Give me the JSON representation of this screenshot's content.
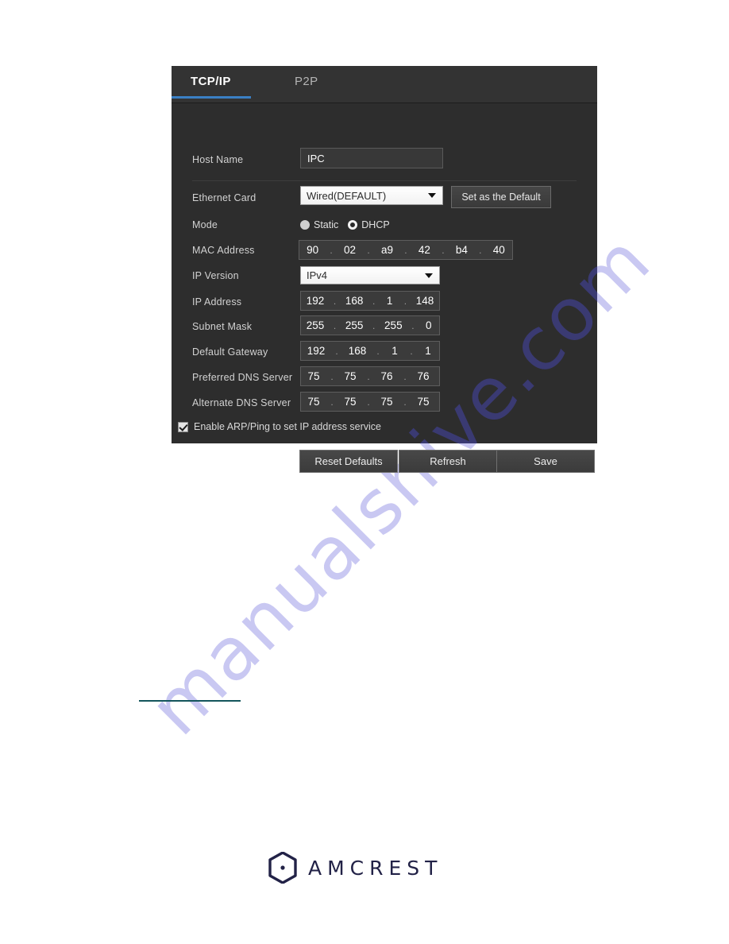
{
  "page": {
    "watermark_text": "manualshive.com",
    "watermark_color": "#c9c8f2"
  },
  "panel": {
    "accent_color": "#3a7fc4",
    "background_color": "#2d2d2d",
    "tabs": [
      {
        "id": "tcpip",
        "label": "TCP/IP",
        "active": true
      },
      {
        "id": "p2p",
        "label": "P2P",
        "active": false
      }
    ],
    "rows": {
      "host_name": {
        "label": "Host Name",
        "value": "IPC"
      },
      "ethernet_card": {
        "label": "Ethernet Card",
        "value": "Wired(DEFAULT)",
        "set_default_button": "Set as the Default"
      },
      "mode": {
        "label": "Mode",
        "options": [
          {
            "label": "Static",
            "selected": false
          },
          {
            "label": "DHCP",
            "selected": true
          }
        ]
      },
      "mac_address": {
        "label": "MAC Address",
        "octets": [
          "90",
          "02",
          "a9",
          "42",
          "b4",
          "40"
        ]
      },
      "ip_version": {
        "label": "IP Version",
        "value": "IPv4"
      },
      "ip_address": {
        "label": "IP Address",
        "octets": [
          "192",
          "168",
          "1",
          "148"
        ]
      },
      "subnet_mask": {
        "label": "Subnet Mask",
        "octets": [
          "255",
          "255",
          "255",
          "0"
        ]
      },
      "default_gateway": {
        "label": "Default Gateway",
        "octets": [
          "192",
          "168",
          "1",
          "1"
        ]
      },
      "preferred_dns": {
        "label": "Preferred DNS Server",
        "octets": [
          "75",
          "75",
          "76",
          "76"
        ]
      },
      "alternate_dns": {
        "label": "Alternate DNS Server",
        "octets": [
          "75",
          "75",
          "75",
          "75"
        ]
      },
      "arp_ping": {
        "label": "Enable ARP/Ping to set IP address service",
        "checked": true
      }
    },
    "actions": [
      {
        "id": "reset-defaults",
        "label": "Reset Defaults"
      },
      {
        "id": "refresh",
        "label": "Refresh"
      },
      {
        "id": "save",
        "label": "Save"
      }
    ]
  },
  "footer": {
    "brand": "AMCREST",
    "brand_color": "#222247"
  }
}
